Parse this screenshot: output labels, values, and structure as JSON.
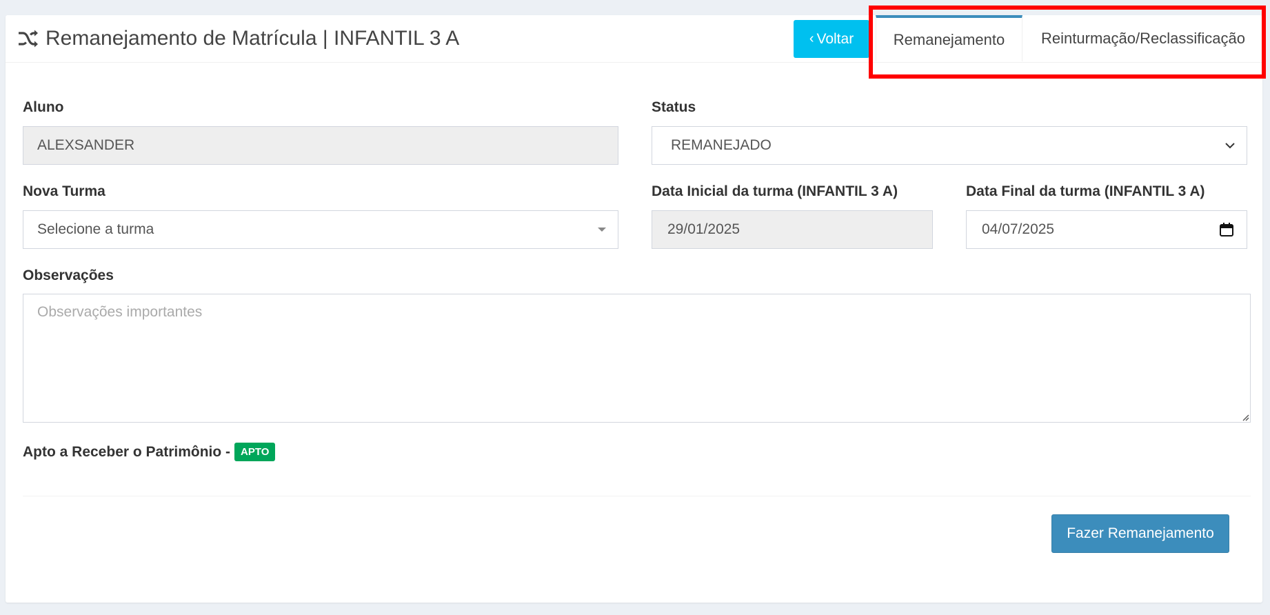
{
  "header": {
    "title": "Remanejamento de Matrícula | INFANTIL 3 A",
    "title_icon": "shuffle-icon",
    "back_button": "Voltar",
    "tabs": [
      {
        "label": "Remanejamento",
        "active": true
      },
      {
        "label": "Reinturmação/Reclassificação",
        "active": false
      }
    ]
  },
  "form": {
    "aluno": {
      "label": "Aluno",
      "value": "ALEXSANDER"
    },
    "status": {
      "label": "Status",
      "value": "REMANEJADO"
    },
    "nova_turma": {
      "label": "Nova Turma",
      "value": "Selecione a turma"
    },
    "data_inicial": {
      "label": "Data Inicial da turma (INFANTIL 3 A)",
      "value": "29/01/2025"
    },
    "data_final": {
      "label": "Data Final da turma (INFANTIL 3 A)",
      "value": "04/07/2025"
    },
    "observacoes": {
      "label": "Observações",
      "placeholder": "Observações importantes"
    },
    "apto": {
      "label": "Apto a Receber o Patrimônio -",
      "badge": "APTO"
    }
  },
  "actions": {
    "submit": "Fazer Remanejamento"
  },
  "colors": {
    "info": "#00c0ef",
    "primary": "#3c8dbc",
    "success": "#00a65a",
    "highlight": "#ff0000"
  }
}
